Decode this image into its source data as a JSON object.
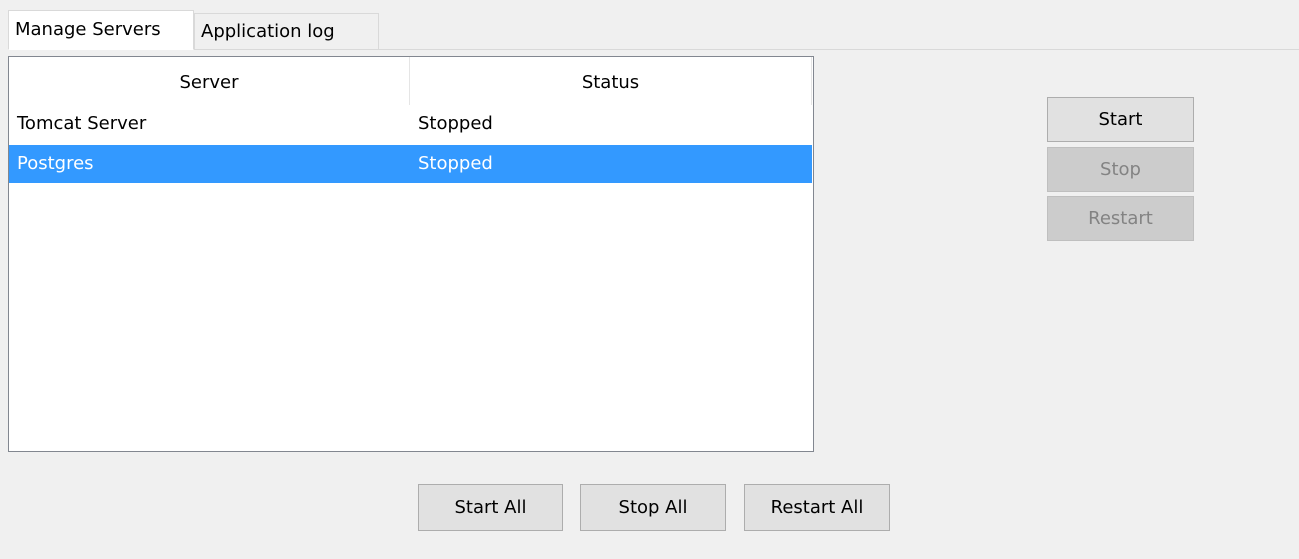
{
  "tabs": {
    "manage_servers": "Manage Servers",
    "application_log": "Application log"
  },
  "grid": {
    "columns": [
      "Server",
      "Status"
    ],
    "rows": [
      {
        "server": "Tomcat Server",
        "status": "Stopped",
        "selected": false
      },
      {
        "server": "Postgres",
        "status": "Stopped",
        "selected": true
      }
    ]
  },
  "actions": {
    "start": "Start",
    "stop": "Stop",
    "restart": "Restart",
    "start_enabled": true,
    "stop_enabled": false,
    "restart_enabled": false
  },
  "bulk_actions": {
    "start_all": "Start All",
    "stop_all": "Stop All",
    "restart_all": "Restart All"
  },
  "colors": {
    "window_bg": "#f0f0f0",
    "selection": "#3399ff",
    "grid_border": "#828790",
    "button_face": "#e1e1e1",
    "disabled_text": "#838383"
  }
}
